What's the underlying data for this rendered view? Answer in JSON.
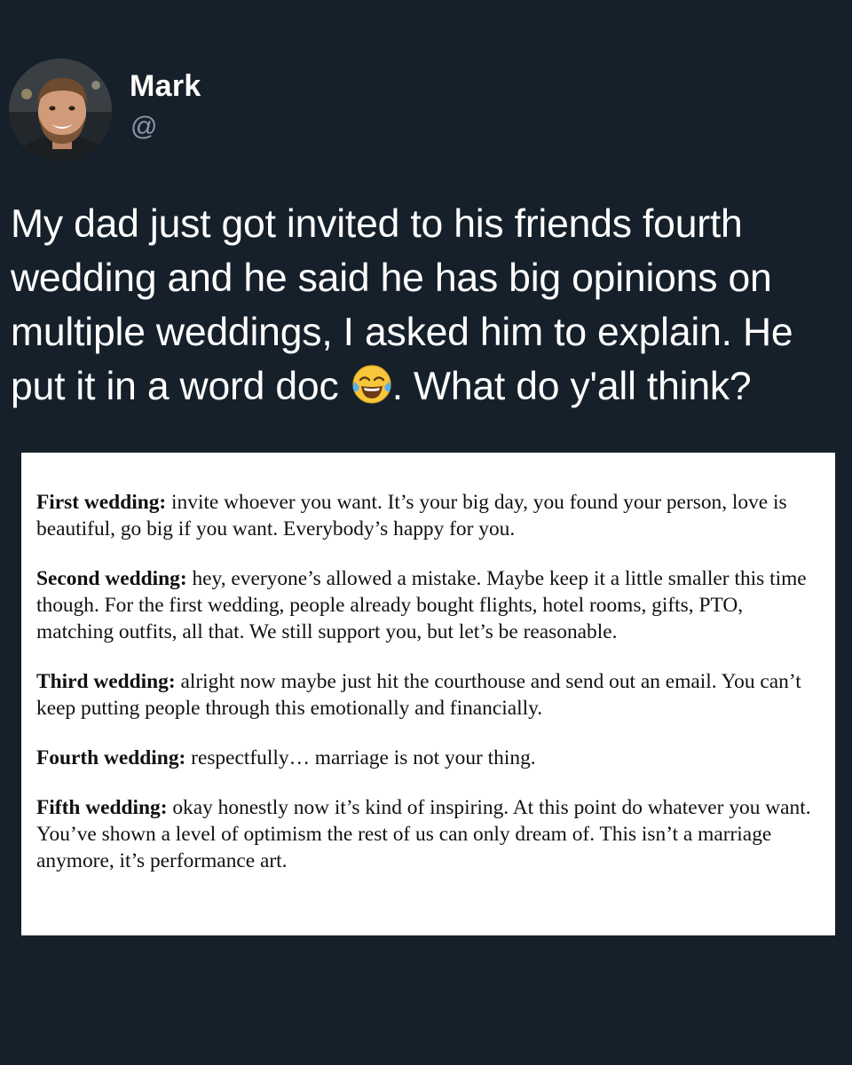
{
  "tweet": {
    "author_name": "Mark",
    "author_handle": "@",
    "text_before_emoji": "My dad just got invited to his friends fourth wedding and he said he has big opinions on multiple weddings, I asked him to explain. He put it in a word doc",
    "emoji": "face-with-tears-of-joy",
    "text_after_emoji": ". What do y'all think?"
  },
  "document": {
    "paragraphs": [
      {
        "label": "First wedding:",
        "text": " invite whoever you want. It’s your big day, you found your person, love is beautiful, go big if you want. Everybody’s happy for you."
      },
      {
        "label": "Second wedding:",
        "text": " hey, everyone’s allowed a mistake. Maybe keep it a little smaller this time though. For the first wedding, people already bought flights, hotel rooms, gifts, PTO, matching outfits, all that. We still support you, but let’s be reasonable."
      },
      {
        "label": "Third wedding:",
        "text": " alright now maybe just hit the courthouse and send out an email. You can’t keep putting people through this emotionally and financially."
      },
      {
        "label": "Fourth wedding:",
        "text": " respectfully… marriage is not your thing."
      },
      {
        "label": "Fifth wedding:",
        "text": " okay honestly now it’s kind of inspiring. At this point do whatever you want. You’ve shown a level of optimism the rest of us can only dream of. This isn’t a marriage anymore, it’s performance art."
      }
    ]
  },
  "colors": {
    "background": "#16202a",
    "handle": "#8899a6",
    "document_background": "#ffffff"
  }
}
